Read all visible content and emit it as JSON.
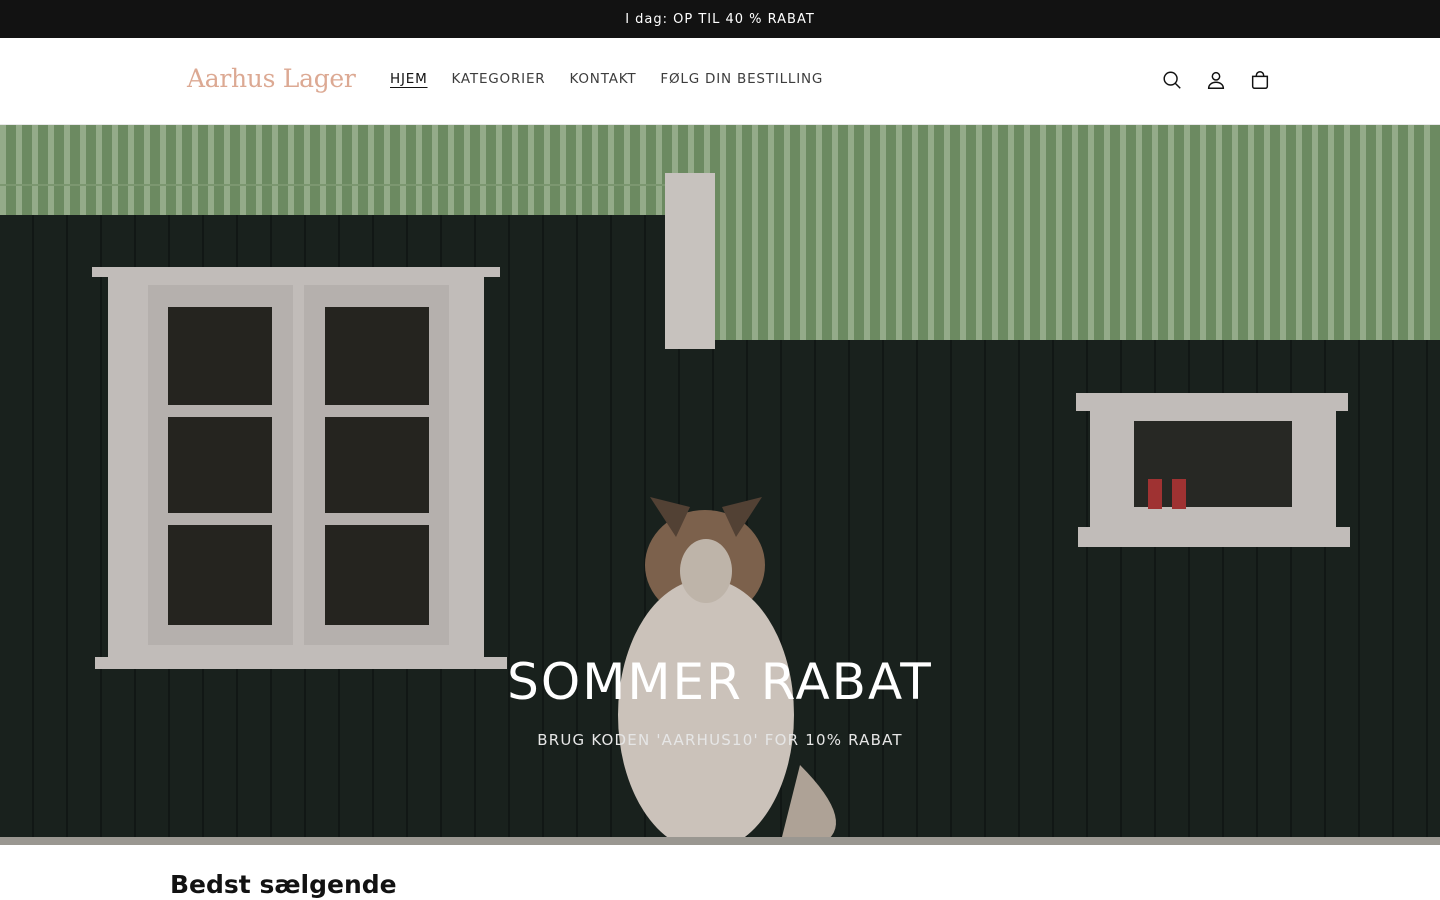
{
  "announcement": {
    "text": "I dag: OP TIL 40 % RABAT"
  },
  "header": {
    "logo_text": "Aarhus Lager",
    "nav": [
      {
        "label": "HJEM",
        "active": true
      },
      {
        "label": "KATEGORIER",
        "active": false
      },
      {
        "label": "KONTAKT",
        "active": false
      },
      {
        "label": "FØLG DIN BESTILLING",
        "active": false
      }
    ],
    "icons": [
      "search-icon",
      "account-icon",
      "cart-icon"
    ]
  },
  "hero": {
    "title": "SOMMER RABAT",
    "subtitle": "BRUG KODEN 'AARHUS10' FOR 10% RABAT"
  },
  "featured": {
    "title": "Bedst sælgende"
  },
  "colors": {
    "announcement_bg": "#121212",
    "logo": "#dca993",
    "roof": "#7c9e6f",
    "wall": "#1c2520",
    "window_frame": "#dcd6d3"
  }
}
